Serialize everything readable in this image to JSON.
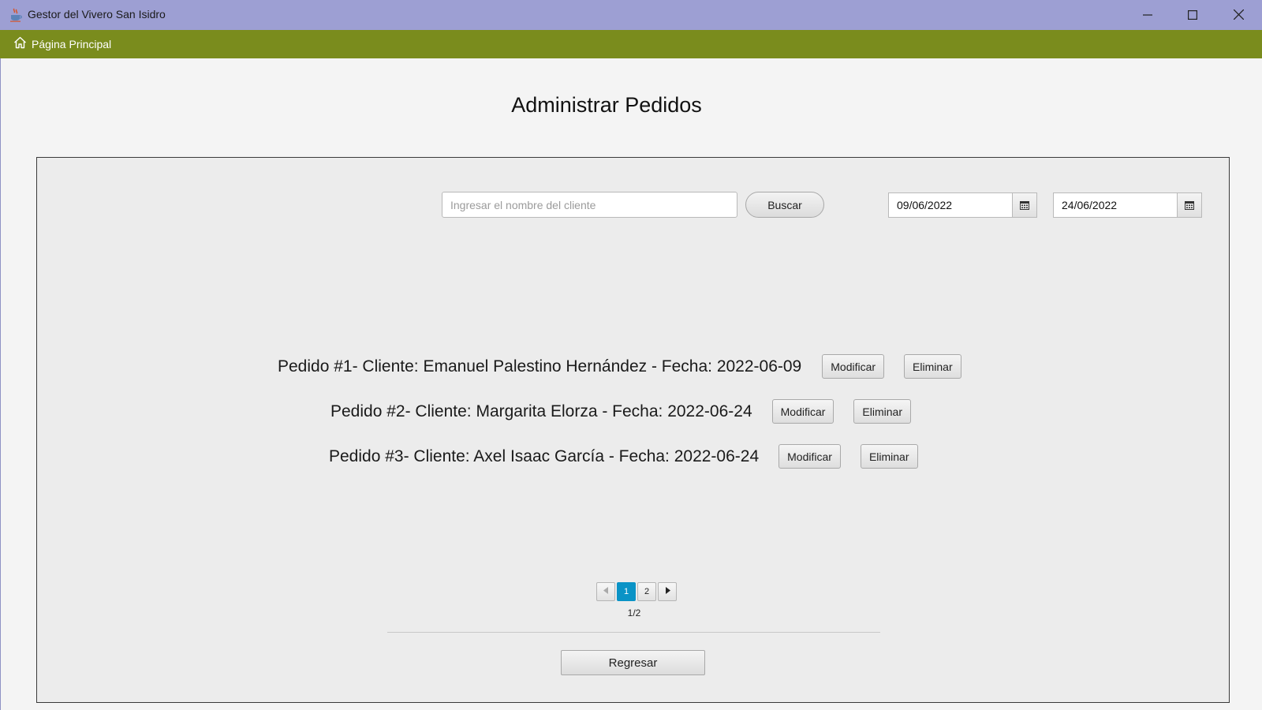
{
  "window": {
    "title": "Gestor del Vivero San Isidro",
    "icon": "java-cup-icon",
    "controls": [
      "minimize-icon",
      "maximize-icon",
      "close-icon"
    ]
  },
  "menubar": {
    "home_label": "Página Principal",
    "home_icon": "home-icon",
    "background": "#7a8c1d"
  },
  "page": {
    "title": "Administrar Pedidos"
  },
  "search": {
    "placeholder": "Ingresar el nombre del cliente",
    "value": "",
    "button_label": "Buscar"
  },
  "date_filter": {
    "from": "09/06/2022",
    "to": "24/06/2022",
    "calendar_icon": "calendar-icon"
  },
  "orders": [
    {
      "text": "Pedido #1- Cliente: Emanuel Palestino Hernández - Fecha: 2022-06-09",
      "modify_label": "Modificar",
      "delete_label": "Eliminar"
    },
    {
      "text": "Pedido #2- Cliente: Margarita Elorza - Fecha: 2022-06-24",
      "modify_label": "Modificar",
      "delete_label": "Eliminar"
    },
    {
      "text": "Pedido #3- Cliente: Axel Isaac García - Fecha: 2022-06-24",
      "modify_label": "Modificar",
      "delete_label": "Eliminar"
    }
  ],
  "pagination": {
    "prev_icon": "chevron-left-icon",
    "next_icon": "chevron-right-icon",
    "pages": [
      "1",
      "2"
    ],
    "current": "1",
    "counter": "1/2",
    "active_color": "#0a93c6"
  },
  "footer": {
    "back_label": "Regresar"
  }
}
